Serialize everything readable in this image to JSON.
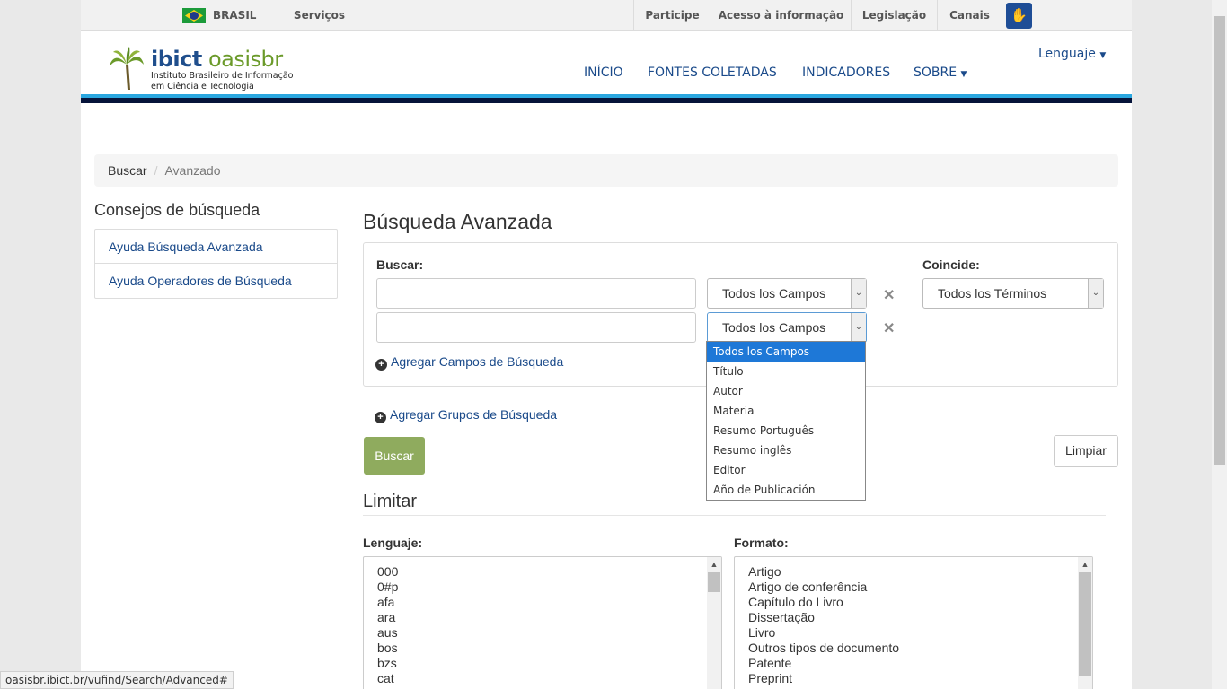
{
  "govbar": {
    "country": "BRASIL",
    "services": "Serviços",
    "links": [
      "Participe",
      "Acesso à informação",
      "Legislação",
      "Canais"
    ]
  },
  "header": {
    "brand_part1": "ibict",
    "brand_part2": "oasisbr",
    "subtitle_line1": "Instituto Brasileiro de Informação",
    "subtitle_line2": "em Ciência e Tecnologia",
    "nav": [
      "INÍCIO",
      "FONTES COLETADAS",
      "INDICADORES",
      "SOBRE"
    ],
    "language_menu": "Lenguaje"
  },
  "breadcrumb": {
    "home": "Buscar",
    "current": "Avanzado"
  },
  "sidebar": {
    "title": "Consejos de búsqueda",
    "links": [
      "Ayuda Búsqueda Avanzada",
      "Ayuda Operadores de Búsqueda"
    ]
  },
  "main": {
    "title": "Búsqueda Avanzada",
    "search_label": "Buscar:",
    "match_label": "Coincide:",
    "field_select_1": "Todos los Campos",
    "field_select_2": "Todos los Campos",
    "match_select": "Todos los Términos",
    "add_fields": "Agregar Campos de Búsqueda",
    "add_groups": "Agregar Grupos de Búsqueda",
    "search_button": "Buscar",
    "clear_button": "Limpiar",
    "field_options": [
      "Todos los Campos",
      "Título",
      "Autor",
      "Materia",
      "Resumo Português",
      "Resumo inglês",
      "Editor",
      "Año de Publicación"
    ]
  },
  "limit": {
    "title": "Limitar",
    "language_label": "Lenguaje:",
    "format_label": "Formato:",
    "languages": [
      "000",
      "0#p",
      "afa",
      "ara",
      "aus",
      "bos",
      "bzs",
      "cat"
    ],
    "formats": [
      "Artigo",
      "Artigo de conferência",
      "Capítulo do Livro",
      "Dissertação",
      "Livro",
      "Outros tipos de documento",
      "Patente",
      "Preprint"
    ]
  },
  "statusbar": {
    "url": "oasisbr.ibict.br/vufind/Search/Advanced#"
  }
}
